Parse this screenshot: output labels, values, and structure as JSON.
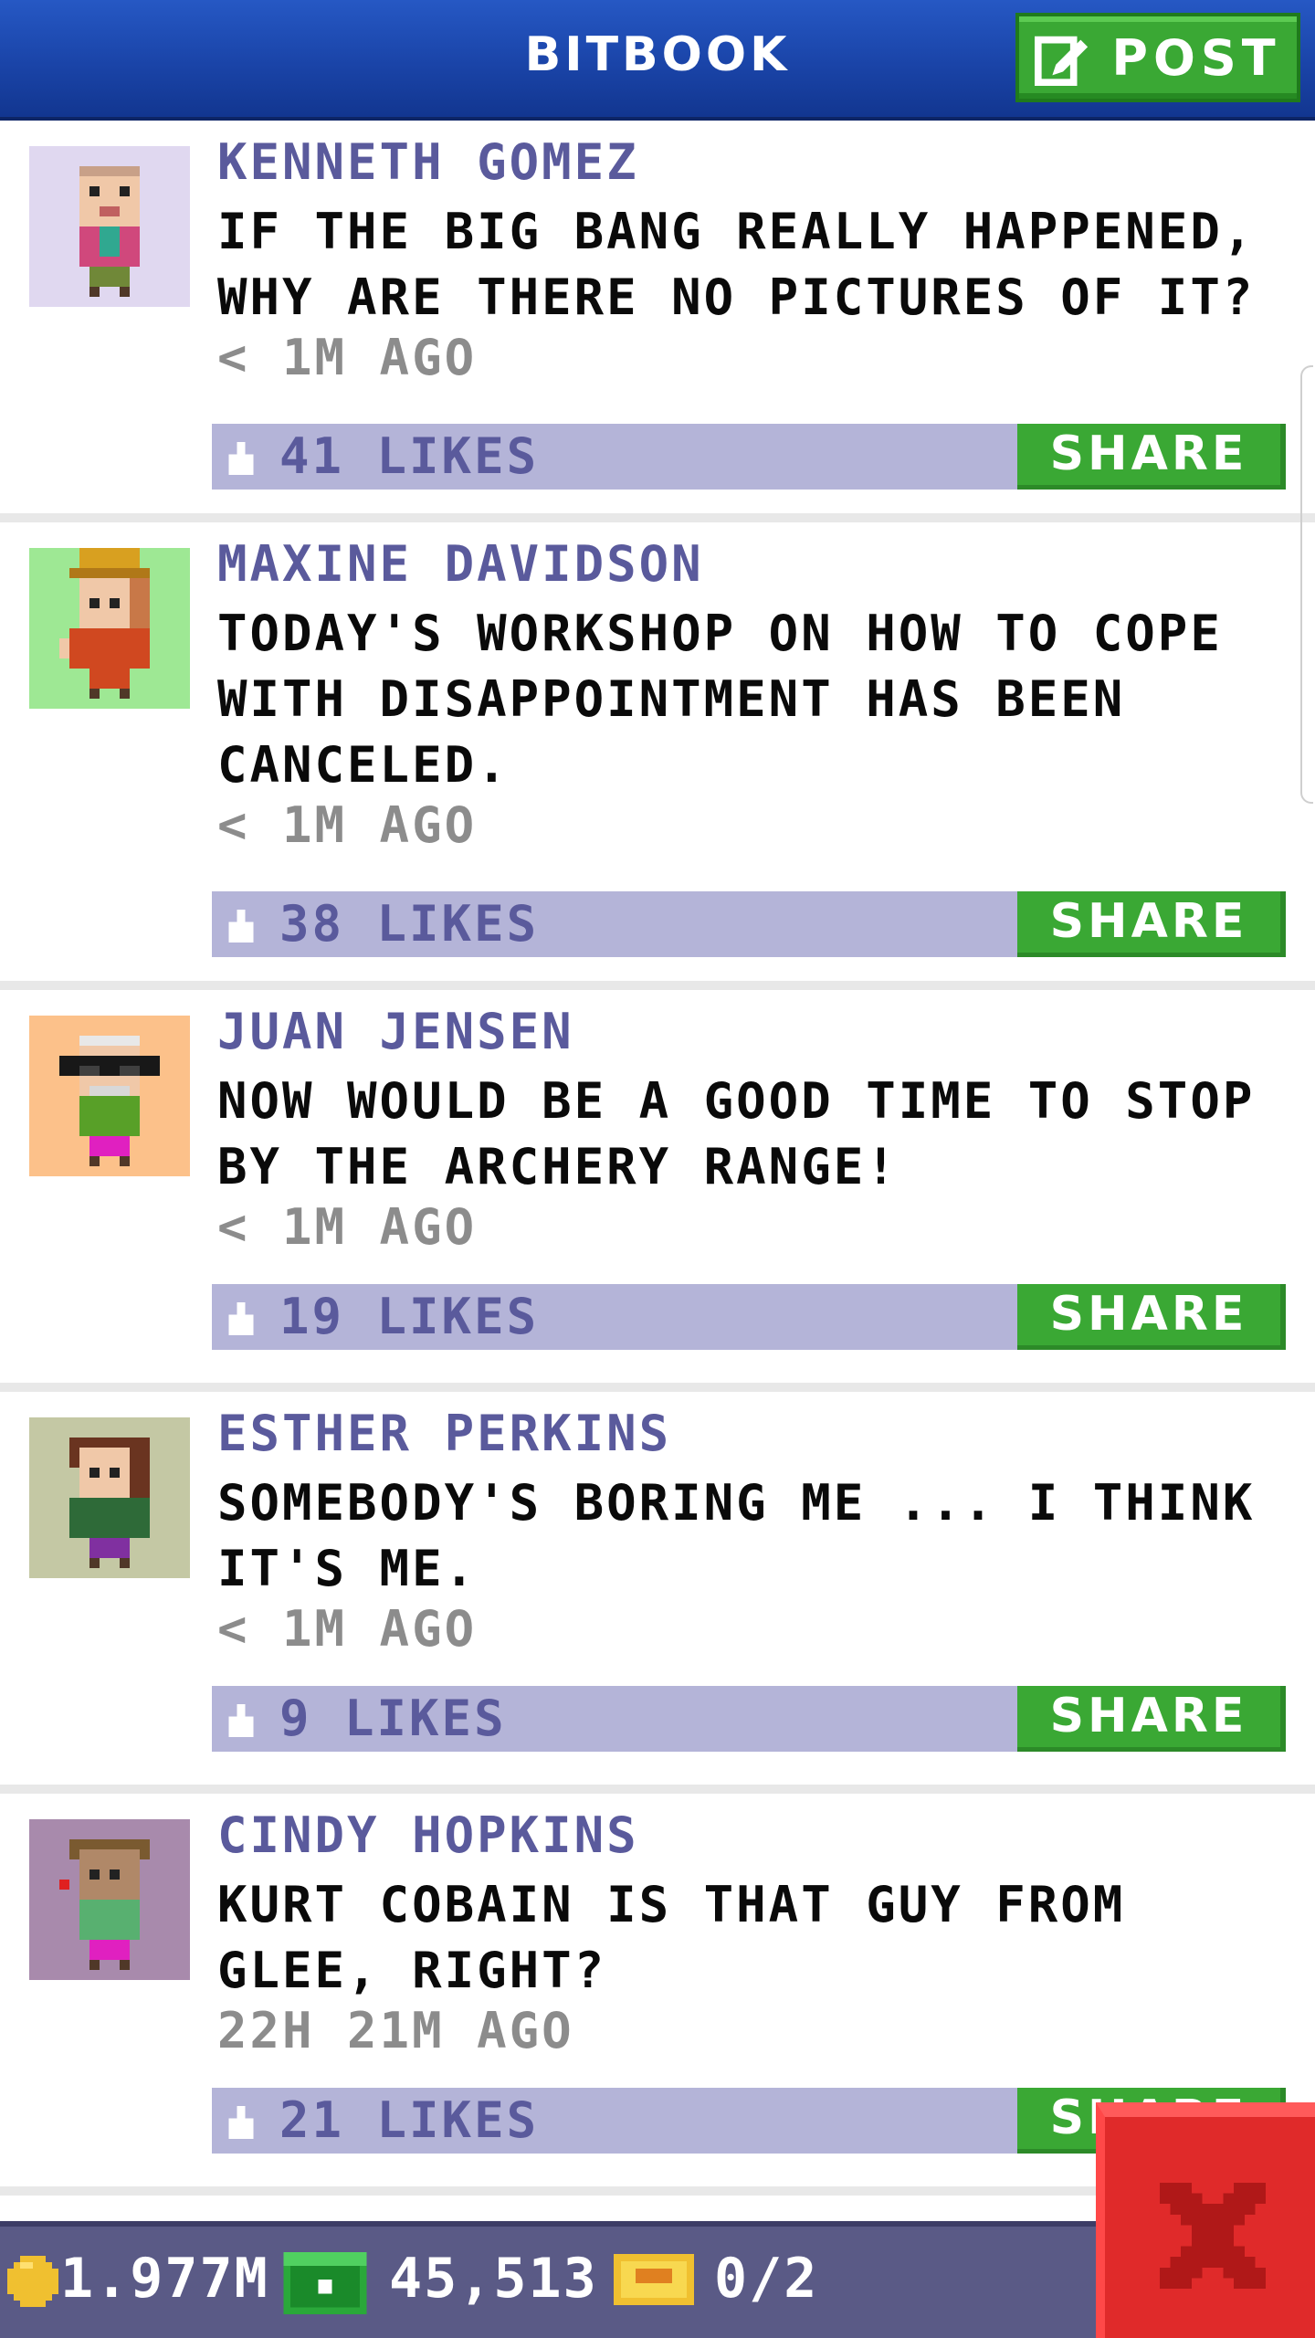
{
  "header": {
    "title": "BITBOOK",
    "post_label": "POST"
  },
  "posts": [
    {
      "author": "KENNETH GOMEZ",
      "message": "IF THE BIG BANG REALLY HAPPENED, WHY ARE THERE NO PICTURES OF IT?",
      "time": "< 1M AGO",
      "likes": "41 LIKES",
      "share": "SHARE",
      "avatar_bg": "#e0d8f0"
    },
    {
      "author": "MAXINE DAVIDSON",
      "message": "TODAY'S WORKSHOP ON HOW TO COPE WITH DISAPPOINTMENT HAS BEEN CANCELED.",
      "time": "< 1M AGO",
      "likes": "38 LIKES",
      "share": "SHARE",
      "avatar_bg": "#9ee894"
    },
    {
      "author": "JUAN JENSEN",
      "message": "NOW WOULD BE A GOOD TIME TO STOP BY THE ARCHERY RANGE!",
      "time": "< 1M AGO",
      "likes": "19 LIKES",
      "share": "SHARE",
      "avatar_bg": "#fcc18a"
    },
    {
      "author": "ESTHER PERKINS",
      "message": "SOMEBODY'S BORING ME ... I THINK IT'S ME.",
      "time": "< 1M AGO",
      "likes": "9 LIKES",
      "share": "SHARE",
      "avatar_bg": "#c4c8a4"
    },
    {
      "author": "CINDY HOPKINS",
      "message": "KURT COBAIN IS THAT GUY FROM GLEE, RIGHT?",
      "time": "22H 21M AGO",
      "likes": "21 LIKES",
      "share": "SHARE",
      "avatar_bg": "#a88aac"
    }
  ],
  "bottom_bar": {
    "coins": "1.977M",
    "bux": "45,513",
    "tickets": "0/2"
  },
  "colors": {
    "header": "#1a44a8",
    "share_green": "#3aa834",
    "like_bar": "#b4b4d8",
    "close_red": "#e02a2a"
  }
}
